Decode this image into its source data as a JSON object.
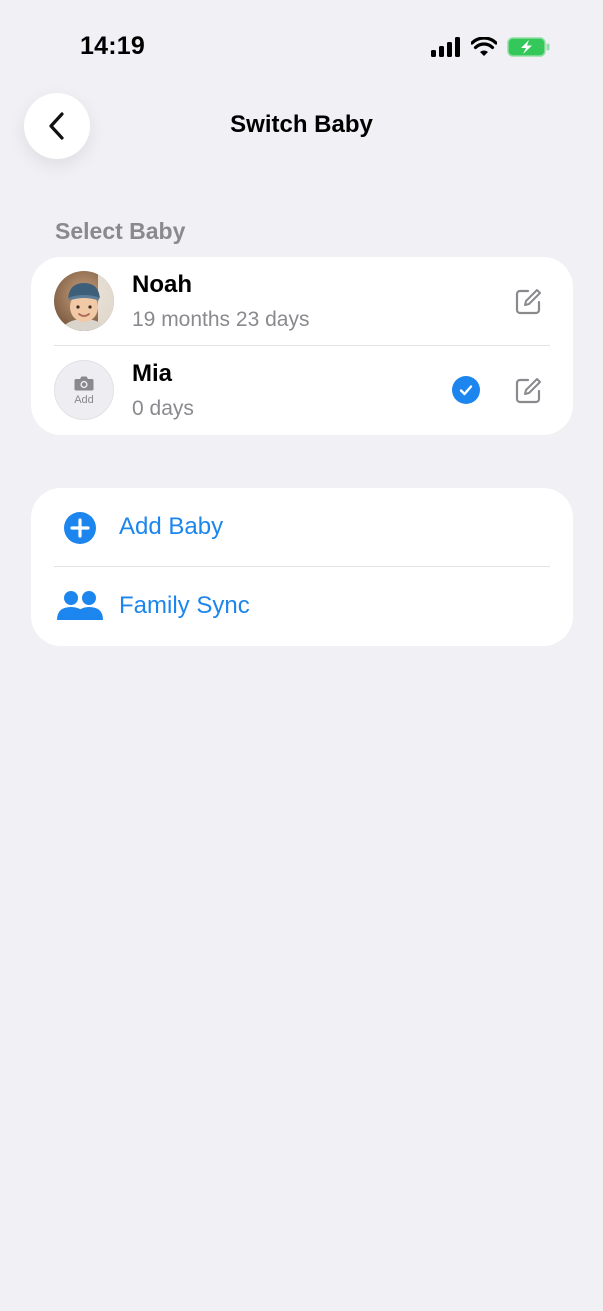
{
  "status_bar": {
    "time": "14:19",
    "icons": [
      "cellular-signal-icon",
      "wifi-icon",
      "battery-charging-icon"
    ]
  },
  "nav": {
    "title": "Switch Baby",
    "back_icon": "chevron-left-icon"
  },
  "section": {
    "label": "Select Baby"
  },
  "babies": [
    {
      "name": "Noah",
      "age": "19 months 23 days",
      "has_photo": true,
      "selected": false
    },
    {
      "name": "Mia",
      "age": "0 days",
      "has_photo": false,
      "photo_placeholder": "Add",
      "selected": true
    }
  ],
  "actions": [
    {
      "label": "Add Baby",
      "icon": "plus-circle-icon"
    },
    {
      "label": "Family Sync",
      "icon": "people-icon"
    }
  ],
  "colors": {
    "accent": "#1C86EE",
    "background": "#F0F0F5",
    "secondary_text": "#8A8A8E",
    "battery_green": "#34C759"
  }
}
